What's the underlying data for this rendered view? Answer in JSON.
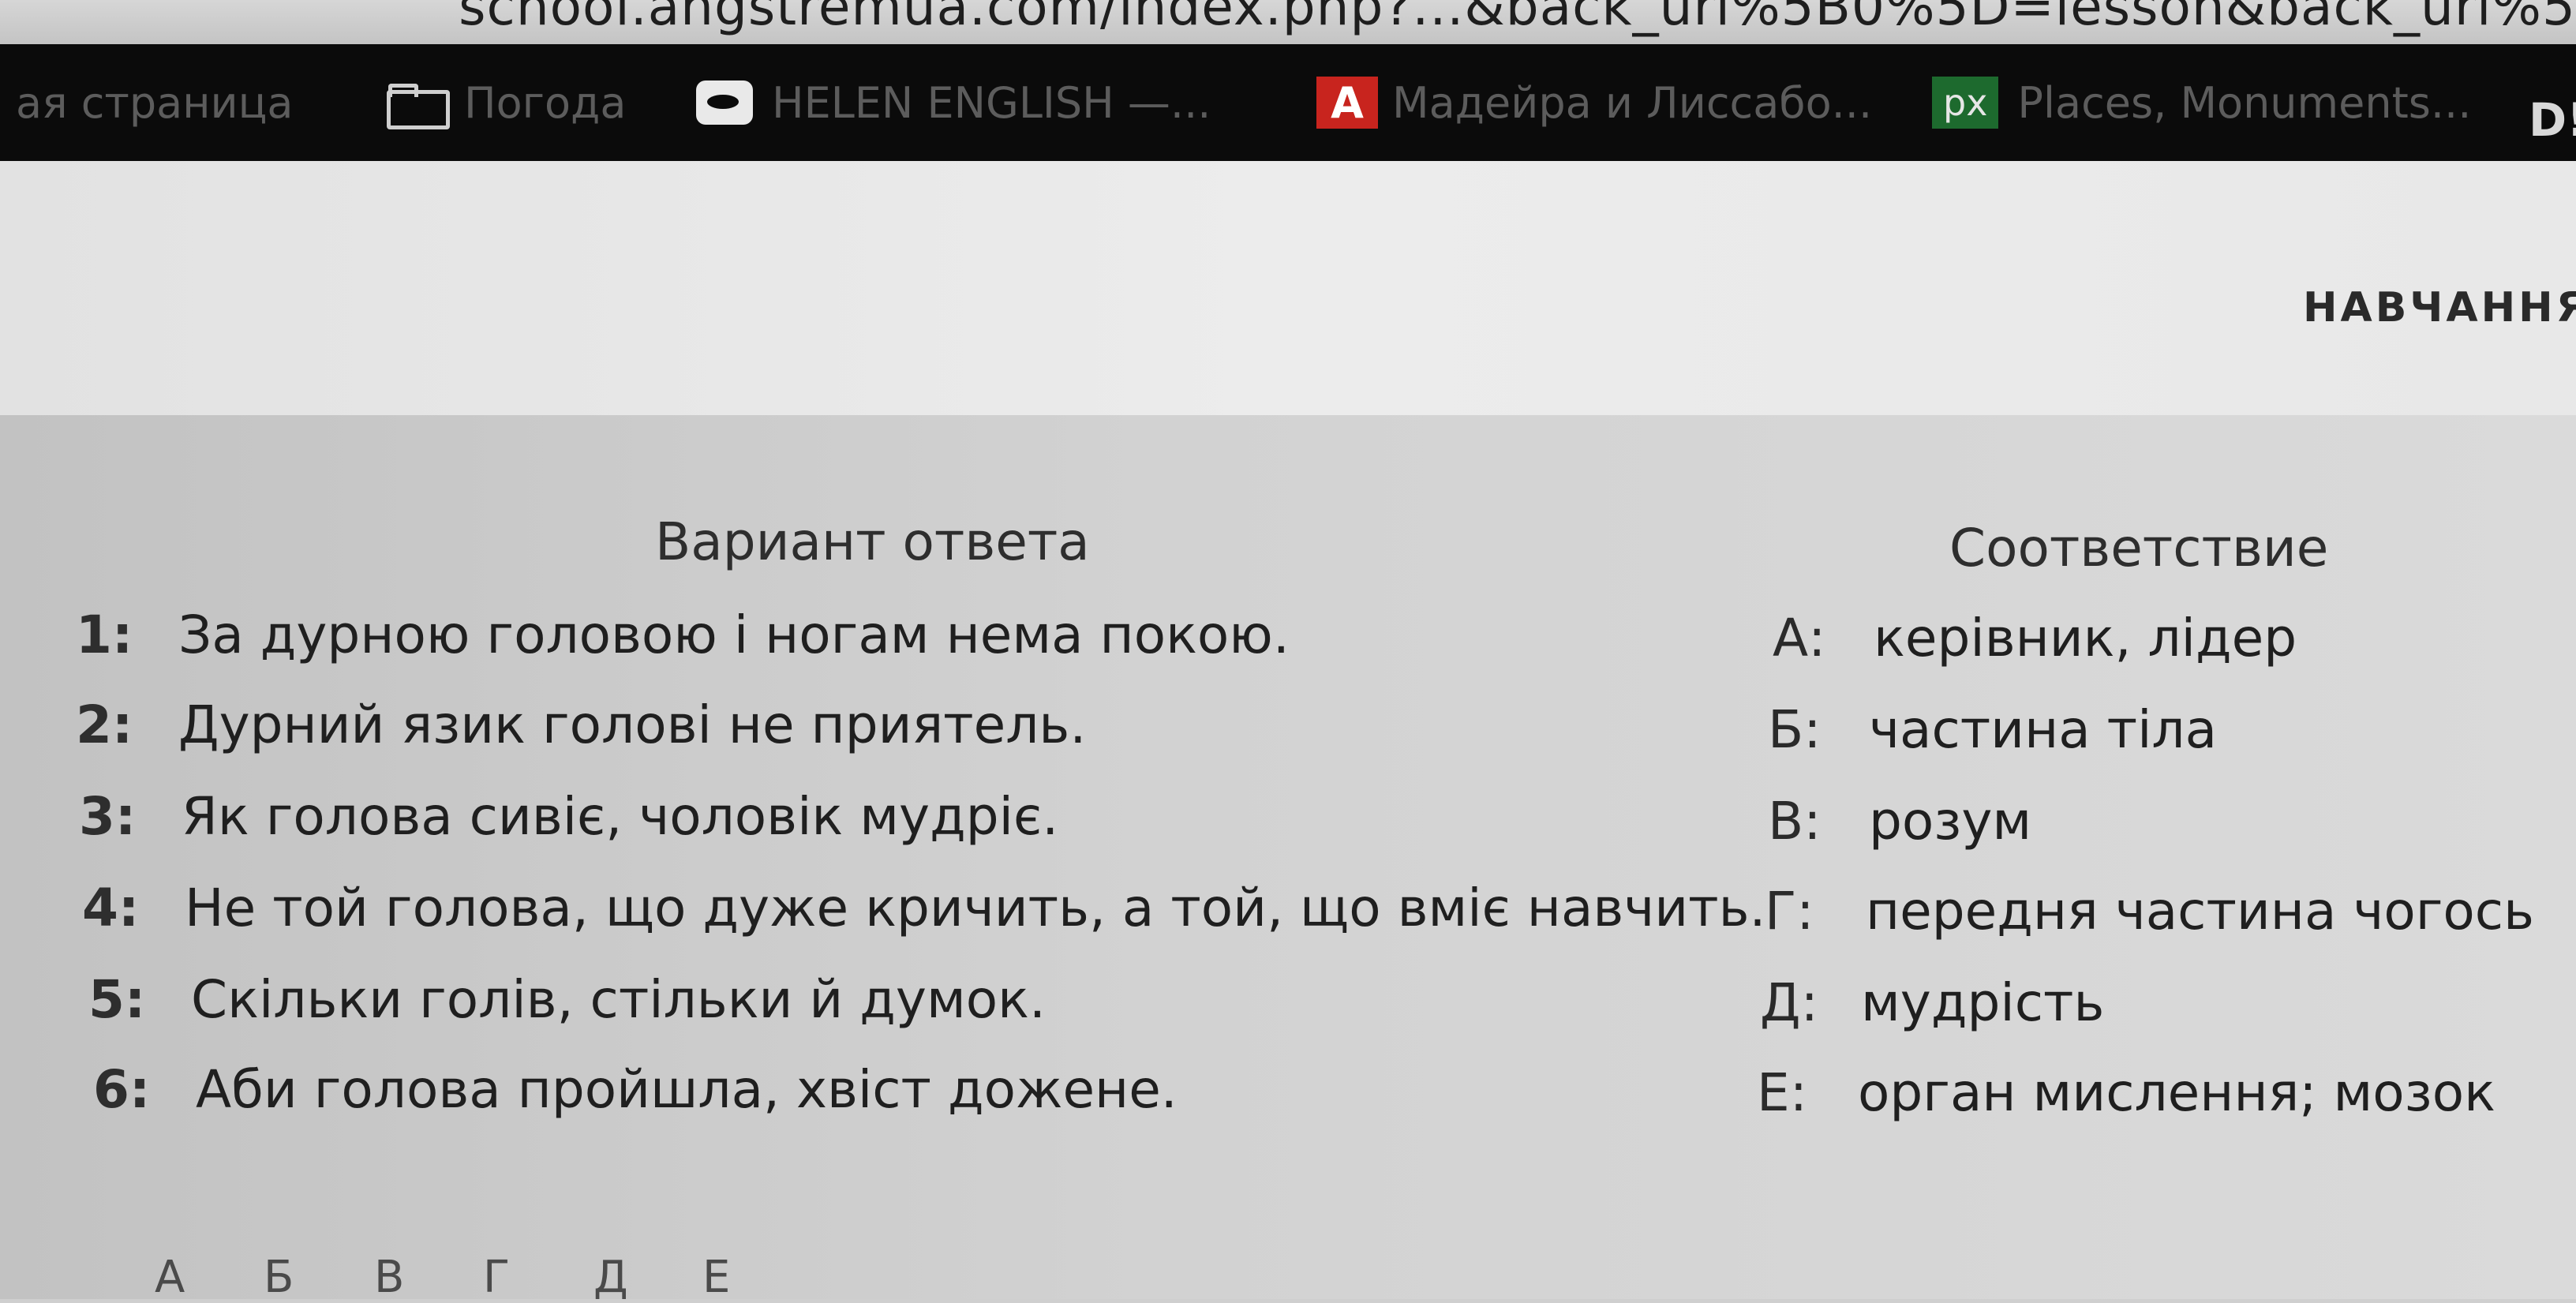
{
  "browser": {
    "url_fragment": "school.angstremua.com/index.php?...&back_url%5B0%5D=lesson&back_url%5",
    "bookmarks": [
      {
        "label": "ая страница",
        "icon": "none"
      },
      {
        "label": "Погода",
        "icon": "folder-icon"
      },
      {
        "label": "HELEN ENGLISH —...",
        "icon": "eye-icon"
      },
      {
        "label": "Мадейра и Лиссабо...",
        "icon": "red-a-icon",
        "icon_text": "A"
      },
      {
        "label": "Places, Monuments...",
        "icon": "px-icon",
        "icon_text": "px"
      }
    ],
    "cutoff_icon_text": "D!"
  },
  "header": {
    "nav_link": "НАВЧАННЯ"
  },
  "task": {
    "left_header": "Вариант ответа",
    "right_header": "Соответствие",
    "questions": [
      {
        "num": "1:",
        "text": "За дурною головою і ногам нема покою."
      },
      {
        "num": "2:",
        "text": "Дурний язик голові не приятель."
      },
      {
        "num": "3:",
        "text": "Як голова сивіє, чоловік мудріє."
      },
      {
        "num": "4:",
        "text": "Не той голова, що дуже кричить, а той, що вміє навчить."
      },
      {
        "num": "5:",
        "text": "Скільки голів, стільки й думок."
      },
      {
        "num": "6:",
        "text": "Аби голова пройшла, хвіст дожене."
      }
    ],
    "answers": [
      {
        "key": "А:",
        "text": "керівник, лідер"
      },
      {
        "key": "Б:",
        "text": "частина тіла"
      },
      {
        "key": "В:",
        "text": "розум"
      },
      {
        "key": "Г:",
        "text": "передня частина чогось"
      },
      {
        "key": "Д:",
        "text": "мудрість"
      },
      {
        "key": "Е:",
        "text": "орган мислення; мозок"
      }
    ],
    "answer_grid_letters": [
      "А",
      "Б",
      "В",
      "Г",
      "Д",
      "Е"
    ]
  },
  "colors": {
    "bookmark_bar": "#0b0b0b",
    "header_panel": "#e6e6e6",
    "content_bg": "#d0d0d0",
    "text": "#1f1f1f",
    "red_icon": "#c8241e",
    "px_icon": "#1d6a2e"
  }
}
